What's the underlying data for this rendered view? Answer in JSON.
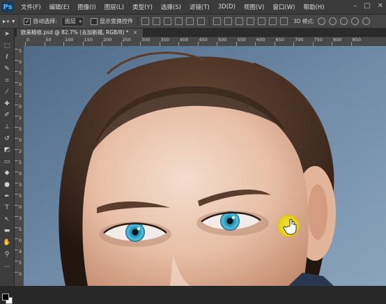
{
  "app": {
    "logo": "Ps"
  },
  "menu": [
    "文件(F)",
    "编辑(E)",
    "图像(I)",
    "图层(L)",
    "类型(Y)",
    "选择(S)",
    "滤镜(T)",
    "3D(D)",
    "视图(V)",
    "窗口(W)",
    "帮助(H)"
  ],
  "window_controls": {
    "minimize": "–",
    "maximize": "□",
    "close": "✕"
  },
  "options": {
    "auto_select_label": "自动选择:",
    "auto_select_value": "图层",
    "show_transform_label": "显示变换控件",
    "threed_mode_label": "3D 模式:"
  },
  "document": {
    "tab_title": "欧美精修.psd @ 82.7% (去加新描, RGB/8) *",
    "close": "×"
  },
  "ruler": {
    "top_labels": [
      "0",
      "50",
      "100",
      "150",
      "200",
      "250",
      "300",
      "350",
      "400",
      "450",
      "500",
      "550",
      "600",
      "650",
      "700",
      "750",
      "800",
      "850"
    ],
    "left_labels": [
      "5",
      "0",
      "5",
      "0",
      "1",
      "0",
      "1",
      "5",
      "0",
      "2",
      "5",
      "0",
      "3",
      "5",
      "0",
      "3",
      "5",
      "0",
      "4",
      "5",
      "0"
    ]
  },
  "tools": [
    "move",
    "marquee",
    "lasso",
    "quick-select",
    "crop",
    "eyedropper",
    "healing",
    "brush",
    "clone-stamp",
    "history-brush",
    "eraser",
    "gradient",
    "blur",
    "dodge",
    "pen",
    "type",
    "path-select",
    "shape",
    "hand",
    "zoom",
    "more"
  ],
  "colors": {
    "accent": "#2fa8e8",
    "cursor_highlight": "#f2e01c"
  }
}
